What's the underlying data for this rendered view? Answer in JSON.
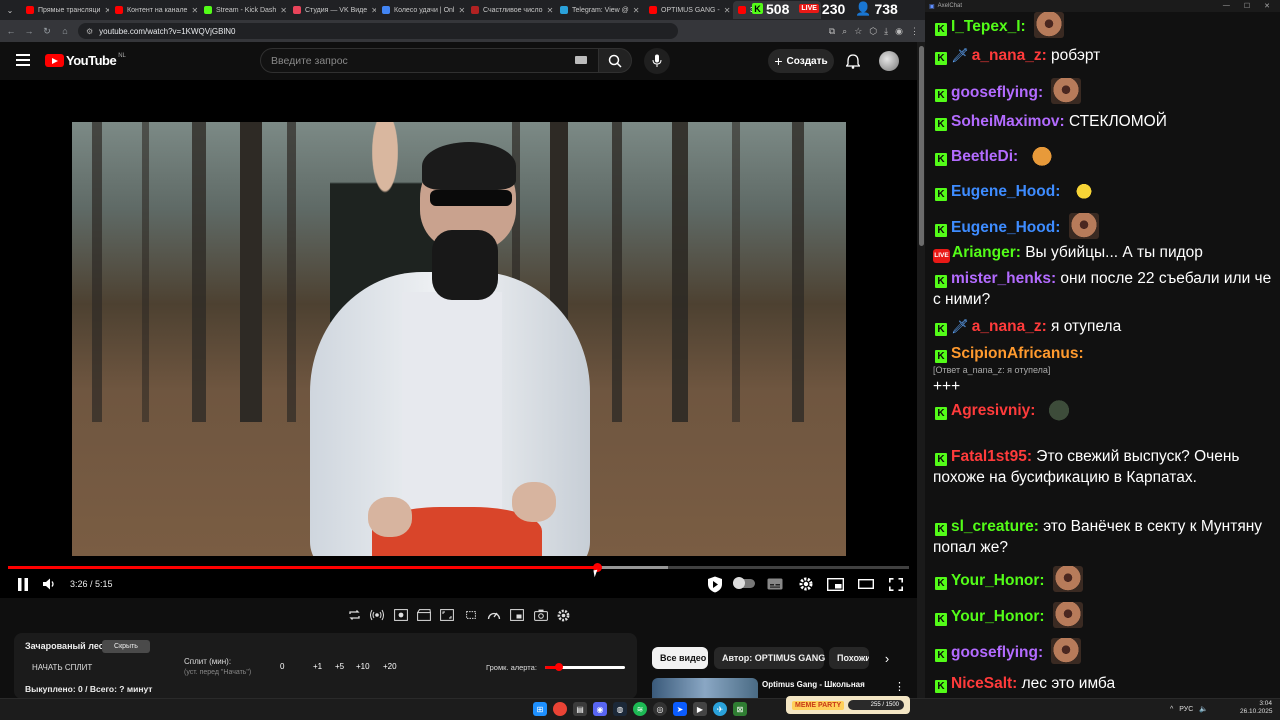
{
  "browser": {
    "tabs": [
      {
        "label": "Прямые трансляци",
        "color": "#ff0000"
      },
      {
        "label": "Контент на канале",
        "color": "#ff0000"
      },
      {
        "label": "Stream - Kick Dash",
        "color": "#53fc18"
      },
      {
        "label": "Студия — VK Виде",
        "color": "#e9445a"
      },
      {
        "label": "Колесо удачи | Onl",
        "color": "#4285f4"
      },
      {
        "label": "Счастливое число",
        "color": "#b22222"
      },
      {
        "label": "Telegram: View @",
        "color": "#2aa1da"
      },
      {
        "label": "OPTIMUS GANG -",
        "color": "#ff0000"
      },
      {
        "label": "Зач",
        "color": "#ff0000"
      }
    ],
    "url": "youtube.com/watch?v=1KWQVjGBlN0"
  },
  "counters": {
    "kick": "508",
    "vk": "230",
    "viewers": "738"
  },
  "youtube": {
    "logo_text": "YouTube",
    "country": "NL",
    "search_placeholder": "Введите запрос",
    "create_label": "Создать"
  },
  "player": {
    "current_time": "3:26",
    "duration": "5:15",
    "time_separator": " / ",
    "played_fraction": 0.654,
    "buffered_fraction": 0.733
  },
  "panel": {
    "title": "Зачарованый лес",
    "hide_label": "Скрыть",
    "start_split": "НАЧАТЬ СПЛИТ",
    "split_label": "Сплит (мин):",
    "split_hint": "(уст. перед \"Начать\")",
    "split_value": "0",
    "split_buttons": [
      "+1",
      "+5",
      "+10",
      "+20"
    ],
    "alert_label": "Громк. алерта:",
    "alert_level": 0.18,
    "bought": "Выкуплено: 0 / Всего: ? минут"
  },
  "chips": {
    "all": "Все видео",
    "author": "Автор: OPTIMUS GANG",
    "similar": "Похожие"
  },
  "reco": {
    "title": "Optimus Gang - Школьная"
  },
  "chat": {
    "window_title": "AxelChat",
    "messages": [
      {
        "user": "I_Tepex_I",
        "color": "#53fc18",
        "text": "",
        "emote": "face"
      },
      {
        "user": "a_nana_z",
        "color": "#ff3b3b",
        "text": "робэрт",
        "sword": true
      },
      {
        "user": "gooseflying",
        "color": "#b36bff",
        "text": "",
        "emote": "face"
      },
      {
        "user": "SoheiMaximov",
        "color": "#b36bff",
        "text": "СТЕКЛОМОЙ"
      },
      {
        "user": "BeetleDi",
        "color": "#b36bff",
        "text": "",
        "emote": "dog"
      },
      {
        "user": "Eugene_Hood",
        "color": "#3e8cff",
        "text": "",
        "emote": "bee"
      },
      {
        "user": "Eugene_Hood",
        "color": "#3e8cff",
        "text": "",
        "emote": "face"
      },
      {
        "user": "Arianger",
        "color": "#53fc18",
        "text": "Вы убийцы... А ты пидор",
        "live": true
      },
      {
        "user": "mister_henks",
        "color": "#b36bff",
        "text": "они после 22 съебали или че с ними?"
      },
      {
        "user": "a_nana_z",
        "color": "#ff3b3b",
        "text": "я отупела",
        "sword": true
      },
      {
        "user": "ScipionAfricanus",
        "color": "#ff9a2e",
        "text": "",
        "reply": "[Ответ a_nana_z: я отупела]",
        "after": "+++"
      },
      {
        "user": "Agresivniy",
        "color": "#ff3b3b",
        "text": "",
        "emote": "frog"
      },
      {
        "user": "Fatal1st95",
        "color": "#ff3b3b",
        "text": "Это свежий выспуск? Очень похоже на бусификацию в Карпатах."
      },
      {
        "user": "sl_creature",
        "color": "#53fc18",
        "text": "это Ванёчек в секту к Мунтяну попал же?"
      },
      {
        "user": "Your_Honor",
        "color": "#53fc18",
        "text": "",
        "emote": "face"
      },
      {
        "user": "Your_Honor",
        "color": "#53fc18",
        "text": "",
        "emote": "face"
      },
      {
        "user": "gooseflying",
        "color": "#b36bff",
        "text": "",
        "emote": "face"
      },
      {
        "user": "NiceSalt",
        "color": "#ff3b3b",
        "text": "лес это имба"
      }
    ]
  },
  "taskbar": {
    "overlay_label": "MEME PARTY",
    "overlay_value": "255 / 1500",
    "lang": "РУС",
    "time": "3:04",
    "date": "26.10.2025"
  }
}
